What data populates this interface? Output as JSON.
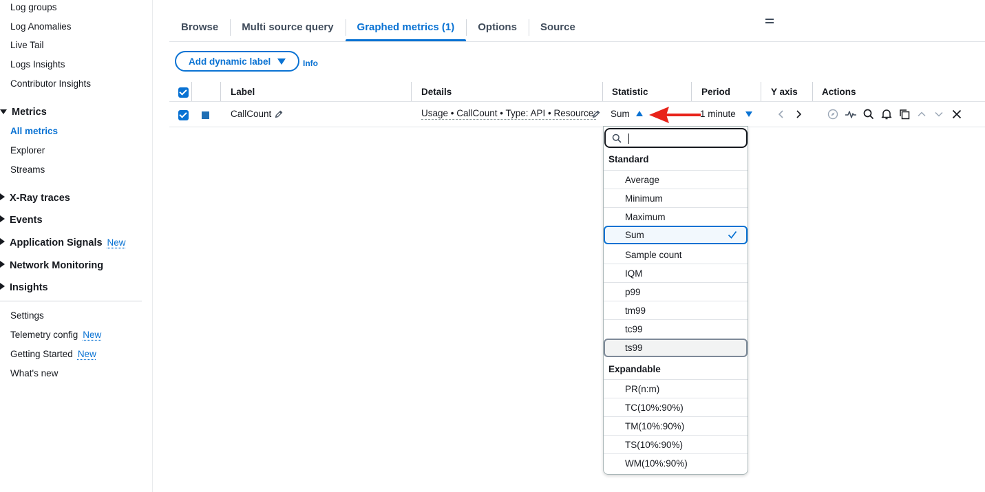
{
  "sidebar": {
    "links_top": [
      "Log groups",
      "Log Anomalies",
      "Live Tail",
      "Logs Insights",
      "Contributor Insights"
    ],
    "metrics_section": "Metrics",
    "metrics_items": [
      "All metrics",
      "Explorer",
      "Streams"
    ],
    "collapsed_sections": [
      {
        "label": "X-Ray traces",
        "badge": ""
      },
      {
        "label": "Events",
        "badge": ""
      },
      {
        "label": "Application Signals",
        "badge": "New"
      },
      {
        "label": "Network Monitoring",
        "badge": ""
      },
      {
        "label": "Insights",
        "badge": ""
      }
    ],
    "links_bottom": [
      {
        "label": "Settings",
        "badge": ""
      },
      {
        "label": "Telemetry config",
        "badge": "New"
      },
      {
        "label": "Getting Started",
        "badge": "New"
      },
      {
        "label": "What's new",
        "badge": ""
      }
    ]
  },
  "tabs": [
    "Browse",
    "Multi source query",
    "Graphed metrics (1)",
    "Options",
    "Source"
  ],
  "active_tab": "Graphed metrics (1)",
  "toolbar": {
    "dynamic_label": "Add dynamic label",
    "info": "Info"
  },
  "table": {
    "headers": {
      "label": "Label",
      "details": "Details",
      "statistic": "Statistic",
      "period": "Period",
      "y_axis": "Y axis",
      "actions": "Actions"
    },
    "row": {
      "label": "CallCount",
      "details": "Usage • CallCount • Type: API • Resource:",
      "statistic": "Sum",
      "period": "1 minute",
      "color": "#1f6fb5"
    }
  },
  "dropdown": {
    "search_value": "",
    "standard_label": "Standard",
    "standard_options": [
      "Average",
      "Minimum",
      "Maximum",
      "Sum",
      "Sample count",
      "IQM",
      "p99",
      "tm99",
      "tc99",
      "ts99"
    ],
    "selected": "Sum",
    "hovered": "ts99",
    "expandable_label": "Expandable",
    "expandable_options": [
      "PR(n:m)",
      "TC(10%:90%)",
      "TM(10%:90%)",
      "TS(10%:90%)",
      "WM(10%:90%)"
    ]
  },
  "colors": {
    "accent": "#0972d3",
    "annotation_arrow": "#e8231a"
  },
  "icons": {
    "actions": [
      "compass-icon",
      "anomaly-detection-icon",
      "search-icon",
      "bell-icon",
      "copy-icon",
      "chevron-up-icon",
      "chevron-down-icon",
      "close-icon"
    ]
  }
}
